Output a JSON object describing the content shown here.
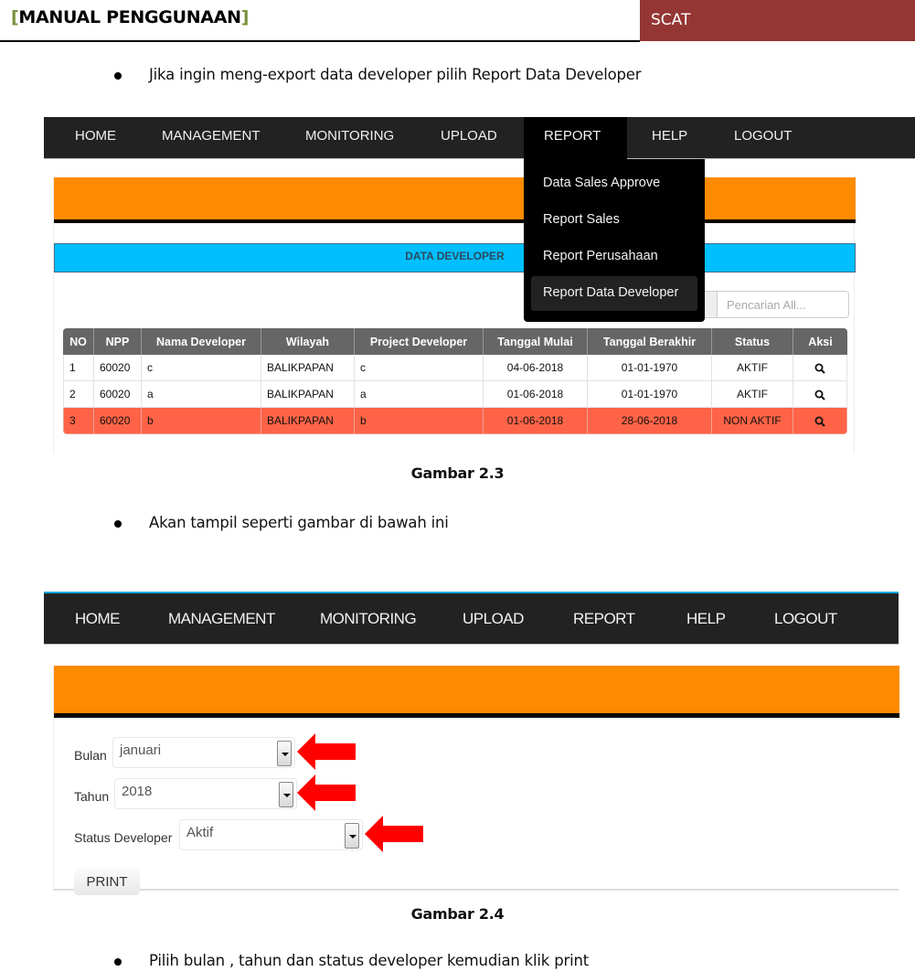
{
  "document": {
    "title_open_bracket": "[",
    "title": "MANUAL PENGGUNAAN",
    "title_close_bracket": "]",
    "tag": "SCAT",
    "bullets": [
      "Jika ingin meng-export data developer pilih Report Data Developer",
      "Akan tampil seperti gambar di bawah ini",
      "Pilih bulan , tahun dan status developer kemudian klik print"
    ],
    "captions": [
      "Gambar 2.3",
      "Gambar 2.4"
    ],
    "colors": {
      "tag_bg": "#943634",
      "bracket": "#76923c",
      "orange": "#fe8a00",
      "blue": "#00bfff",
      "inactive_row": "#ff6347",
      "navbar": "#222222"
    }
  },
  "screenshot1": {
    "nav": [
      {
        "label": "HOME"
      },
      {
        "label": "MANAGEMENT"
      },
      {
        "label": "MONITORING"
      },
      {
        "label": "UPLOAD"
      },
      {
        "label": "REPORT",
        "active": true
      },
      {
        "label": "HELP"
      },
      {
        "label": "LOGOUT"
      }
    ],
    "report_menu": [
      "Data Sales Approve",
      "Report Sales",
      "Report Perusahaan",
      "Report Data Developer"
    ],
    "report_menu_highlighted": "Report Data Developer",
    "section_title": "DATA DEVELOPER",
    "search_placeholder": "Pencarian All...",
    "table": {
      "headers": [
        "NO",
        "NPP",
        "Nama Developer",
        "Wilayah",
        "Project Developer",
        "Tanggal Mulai",
        "Tanggal Berakhir",
        "Status",
        "Aksi"
      ],
      "rows": [
        {
          "no": "1",
          "npp": "60020",
          "nama": "c",
          "wilayah": "BALIKPAPAN",
          "project": "c",
          "mulai": "04-06-2018",
          "berakhir": "01-01-1970",
          "status": "AKTIF",
          "aksi": "search-icon"
        },
        {
          "no": "2",
          "npp": "60020",
          "nama": "a",
          "wilayah": "BALIKPAPAN",
          "project": "a",
          "mulai": "01-06-2018",
          "berakhir": "01-01-1970",
          "status": "AKTIF",
          "aksi": "search-icon"
        },
        {
          "no": "3",
          "npp": "60020",
          "nama": "b",
          "wilayah": "BALIKPAPAN",
          "project": "b",
          "mulai": "01-06-2018",
          "berakhir": "28-06-2018",
          "status": "NON AKTIF",
          "aksi": "search-icon"
        }
      ]
    }
  },
  "screenshot2": {
    "nav": [
      {
        "label": "HOME"
      },
      {
        "label": "MANAGEMENT"
      },
      {
        "label": "MONITORING"
      },
      {
        "label": "UPLOAD"
      },
      {
        "label": "REPORT"
      },
      {
        "label": "HELP"
      },
      {
        "label": "LOGOUT"
      }
    ],
    "form": {
      "bulan_label": "Bulan",
      "bulan_value": "januari",
      "tahun_label": "Tahun",
      "tahun_value": "2018",
      "status_label": "Status Developer",
      "status_value": "Aktif",
      "print_label": "PRINT"
    }
  }
}
